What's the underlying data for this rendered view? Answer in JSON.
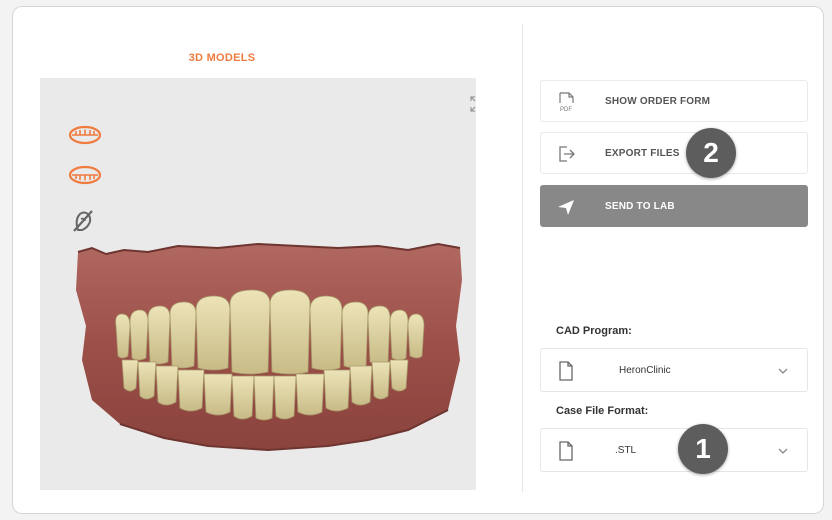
{
  "panel": {
    "title": "3D MODELS"
  },
  "icons": {
    "expand": "expand-icon",
    "upper_jaw": "upper-jaw-icon",
    "lower_jaw": "lower-jaw-icon",
    "visibility": "hide-visibility-icon"
  },
  "actions": [
    {
      "label": "SHOW ORDER FORM",
      "icon": "pdf-icon",
      "icon_text": "PDF"
    },
    {
      "label": "EXPORT FILES",
      "icon": "export-icon"
    },
    {
      "label": "SEND TO LAB",
      "icon": "send-icon"
    }
  ],
  "cad": {
    "label": "CAD Program:",
    "value": "HeronClinic"
  },
  "case_format": {
    "label": "Case File Format:",
    "value": ".STL"
  },
  "badges": {
    "one": "1",
    "two": "2"
  },
  "colors": {
    "accent": "#f07b3f",
    "send_button": "#888888",
    "badge": "#5d5d5d"
  }
}
